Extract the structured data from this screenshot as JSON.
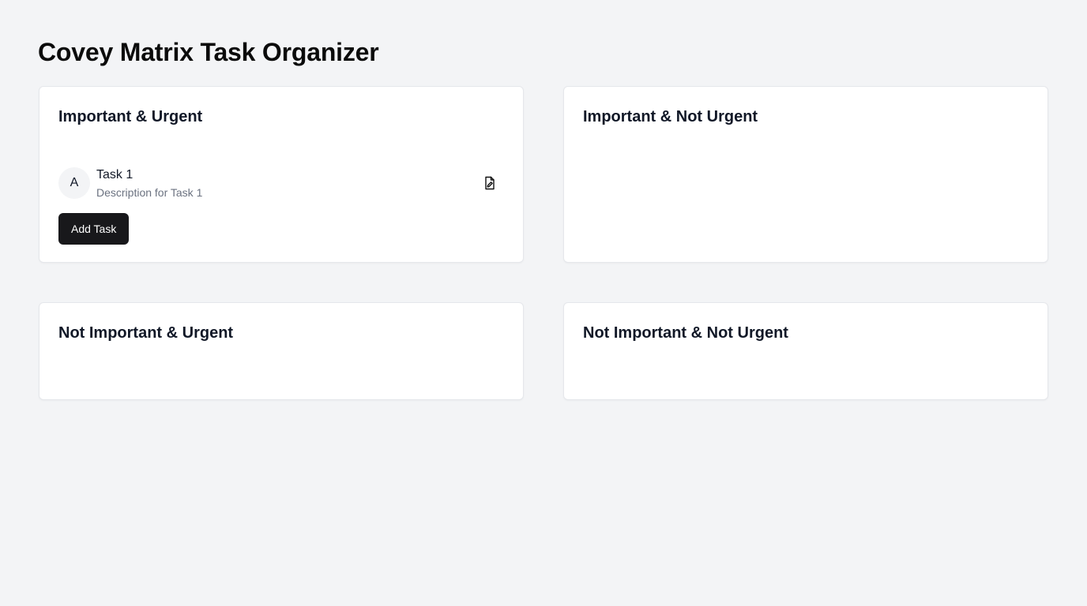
{
  "page": {
    "title": "Covey Matrix Task Organizer"
  },
  "quadrants": [
    {
      "title": "Important & Urgent",
      "tasks": [
        {
          "avatar": "A",
          "name": "Task 1",
          "description": "Description for Task 1",
          "action_icon": "edit-document-icon"
        }
      ],
      "add_label": "Add Task"
    },
    {
      "title": "Important & Not Urgent",
      "tasks": []
    },
    {
      "title": "Not Important & Urgent",
      "tasks": []
    },
    {
      "title": "Not Important & Not Urgent",
      "tasks": []
    }
  ],
  "colors": {
    "background": "#f3f4f6",
    "card": "#ffffff",
    "button": "#18181b",
    "muted_text": "#6b7280"
  }
}
